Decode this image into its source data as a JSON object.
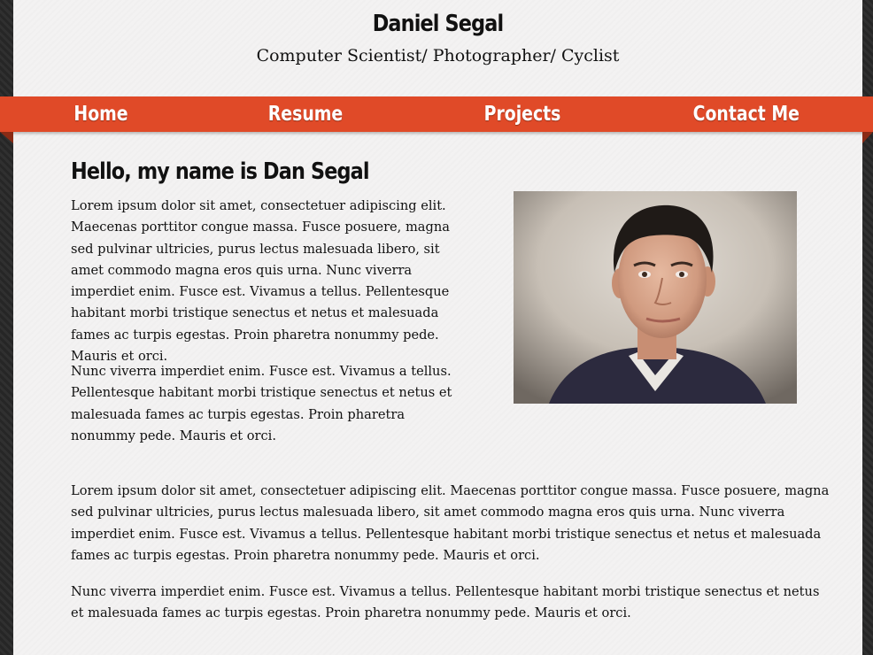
{
  "header": {
    "name": "Daniel Segal",
    "tagline": "Computer Scientist/ Photographer/ Cyclist"
  },
  "nav": {
    "items": [
      "Home",
      "Resume",
      "Projects",
      "Contact Me"
    ],
    "accent_color": "#e04a28"
  },
  "intro": {
    "heading": "Hello, my name is Dan Segal",
    "paragraphs": [
      "Lorem ipsum dolor sit amet, consectetuer adipiscing elit. Maecenas porttitor congue massa. Fusce posuere, magna sed pulvinar ultricies, purus lectus malesuada libero, sit amet commodo magna eros quis urna. Nunc viverra imperdiet enim. Fusce est. Vivamus a tellus. Pellentesque habitant morbi tristique senectus et netus et malesuada fames ac turpis egestas. Proin pharetra nonummy pede. Mauris et orci.",
      "Nunc viverra imperdiet enim. Fusce est. Vivamus a tellus. Pellentesque habitant morbi tristique senectus et netus et malesuada fames ac turpis egestas. Proin pharetra nonummy pede. Mauris et orci."
    ]
  },
  "body": {
    "paragraphs": [
      "Lorem ipsum dolor sit amet, consectetuer adipiscing elit. Maecenas porttitor congue massa. Fusce posuere, magna sed pulvinar ultricies, purus lectus malesuada libero, sit amet commodo magna eros quis urna. Nunc viverra imperdiet enim. Fusce est. Vivamus a tellus. Pellentesque habitant morbi tristique senectus et netus et malesuada fames ac turpis egestas. Proin pharetra nonummy pede. Mauris et orci.",
      "Nunc viverra imperdiet enim. Fusce est. Vivamus a tellus. Pellentesque habitant morbi tristique senectus et netus et malesuada fames ac turpis egestas. Proin pharetra nonummy pede. Mauris et orci."
    ]
  }
}
